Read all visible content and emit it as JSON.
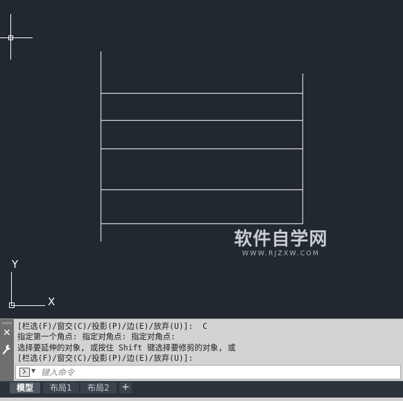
{
  "canvas": {
    "background_color": "#212830",
    "line_color": "#dcdcdc",
    "ucs": {
      "y_label": "Y",
      "x_label": "X"
    }
  },
  "watermark": {
    "main": "软件自学网",
    "sub": "WWW.RJZXW.COM"
  },
  "command_panel": {
    "history": [
      "[栏选(F)/窗交(C)/投影(P)/边(E)/放弃(U)]:  C",
      "指定第一个角点: 指定对角点: 指定对角点:",
      "选择要延伸的对象, 或按住 Shift 键选择要修剪的对象, 或",
      "[栏选(F)/窗交(C)/投影(P)/边(E)/放弃(U)]:"
    ],
    "input_placeholder": "键入命令",
    "input_value": "",
    "close_glyph": "✕"
  },
  "layout_tabs": {
    "tabs": [
      "模型",
      "布局1",
      "布局2"
    ],
    "active": "模型",
    "add_glyph": "+"
  }
}
